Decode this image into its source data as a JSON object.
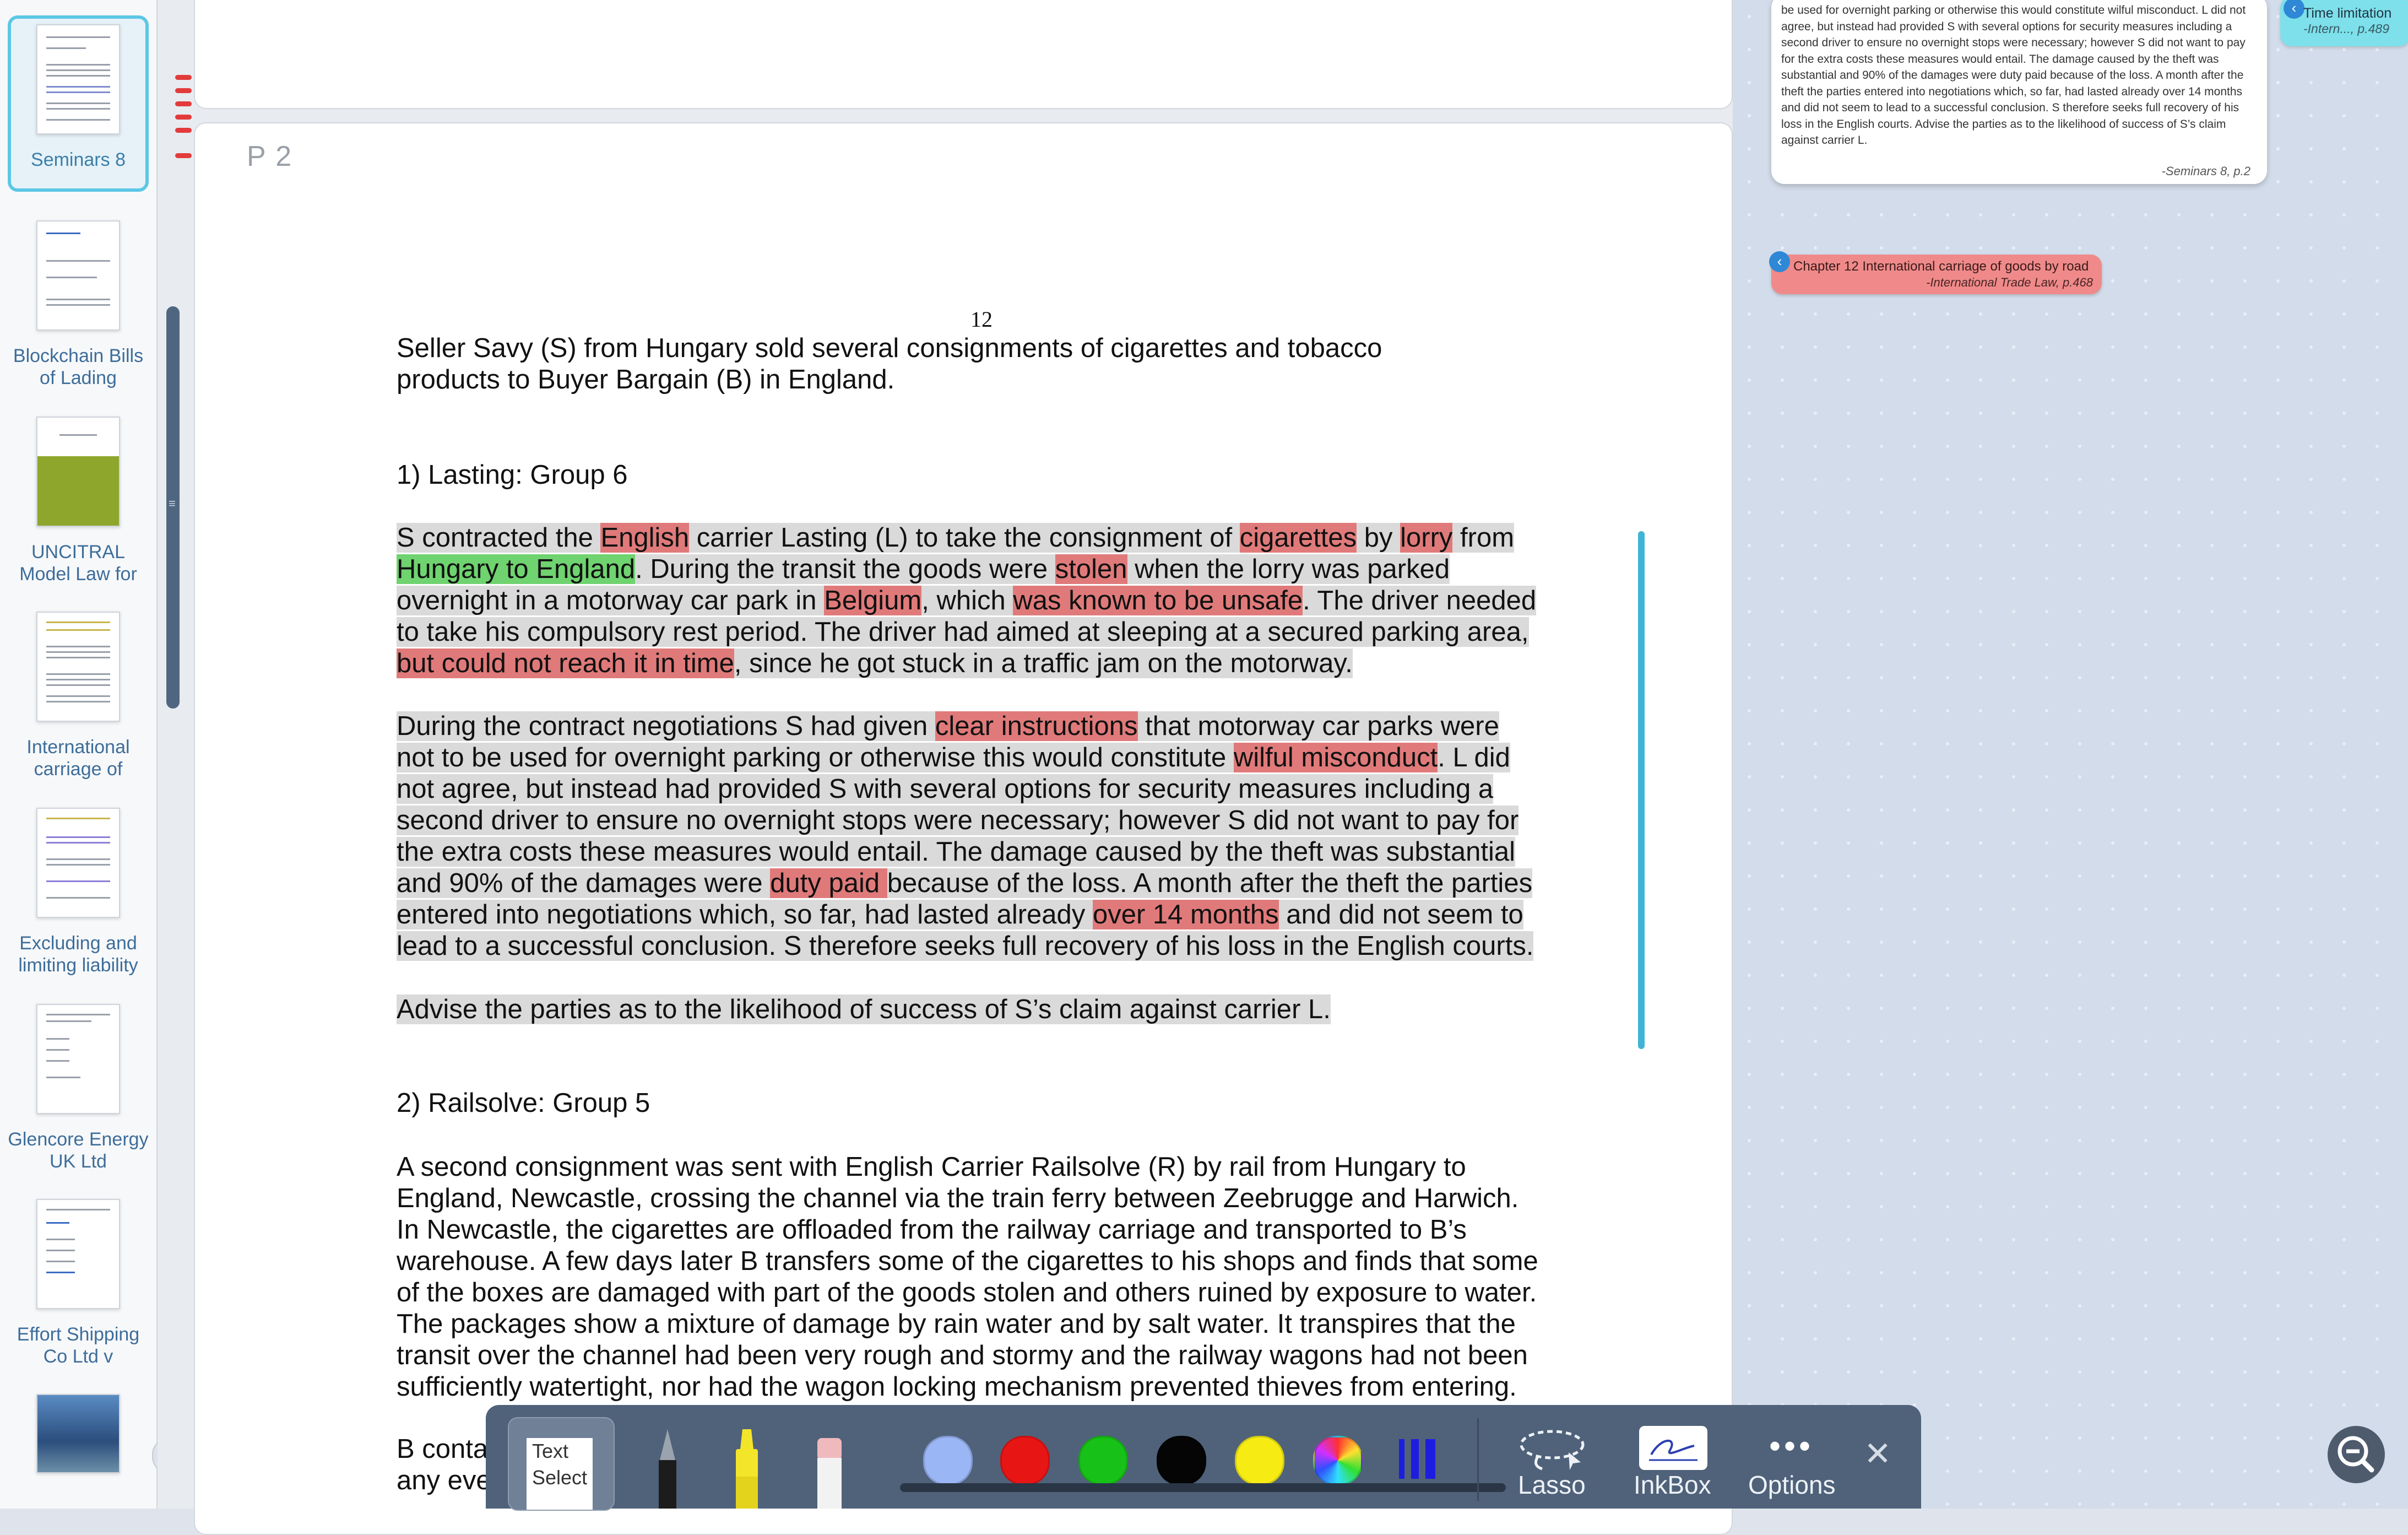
{
  "sidebar": {
    "documents": [
      {
        "label": "Seminars 8",
        "selected": true
      },
      {
        "label": "Blockchain Bills of Lading",
        "selected": false
      },
      {
        "label": "UNCITRAL Model Law for",
        "selected": false
      },
      {
        "label": "International carriage of",
        "selected": false
      },
      {
        "label": "Excluding and limiting liability",
        "selected": false
      },
      {
        "label": "Glencore Energy UK Ltd",
        "selected": false
      },
      {
        "label": "Effort Shipping Co Ltd v",
        "selected": false
      },
      {
        "label": "",
        "selected": false
      }
    ]
  },
  "document": {
    "page_label": "P 2",
    "page_number": "12",
    "intro": [
      "Seller Savy (S) from Hungary sold several consignments of cigarettes and tobacco",
      "products to Buyer Bargain (B) in England."
    ],
    "heading1": "1) Lasting:     Group 6",
    "heading2": "2) Railsolve:  Group 5",
    "p1": [
      [
        [
          "S contracted the ",
          ""
        ],
        [
          "English",
          "red"
        ],
        [
          " carrier Lasting (L) to take the consignment of ",
          ""
        ],
        [
          "cigarettes",
          "red"
        ],
        [
          " by ",
          ""
        ],
        [
          "lorry",
          "red"
        ],
        [
          " from",
          ""
        ]
      ],
      [
        [
          "Hungary to England",
          "green"
        ],
        [
          ". During the transit the goods were ",
          ""
        ],
        [
          "stolen",
          "red"
        ],
        [
          " when the lorry was parked",
          ""
        ]
      ],
      [
        [
          "overnight in a motorway car park in ",
          ""
        ],
        [
          "Belgium",
          "red"
        ],
        [
          ", which ",
          ""
        ],
        [
          "was known to be unsafe",
          "red"
        ],
        [
          ". The driver needed",
          ""
        ]
      ],
      [
        [
          "to take his compulsory rest period. The driver had aimed at sleeping at a secured parking area,",
          ""
        ]
      ],
      [
        [
          "but could not reach it in time",
          "red"
        ],
        [
          ", since he got stuck in a traffic jam on the motorway.",
          ""
        ]
      ]
    ],
    "p2": [
      [
        [
          "During the contract negotiations S had given ",
          ""
        ],
        [
          "clear instructions",
          "red"
        ],
        [
          " that motorway car parks were",
          ""
        ]
      ],
      [
        [
          "not to be used for overnight parking or otherwise this would constitute ",
          ""
        ],
        [
          "wilful misconduct",
          "red"
        ],
        [
          ". L did",
          ""
        ]
      ],
      [
        [
          "not agree, but instead had provided S with several options for security measures including a",
          ""
        ]
      ],
      [
        [
          "second driver to ensure no overnight stops were necessary; however S did not want to pay for",
          ""
        ]
      ],
      [
        [
          "the extra costs these measures would entail. The damage caused by the theft was substantial",
          ""
        ]
      ],
      [
        [
          "and 90% of the damages were ",
          ""
        ],
        [
          "duty paid ",
          "red"
        ],
        [
          "because of the loss. A month after the theft the parties",
          ""
        ]
      ],
      [
        [
          "entered into negotiations which, so far, had lasted already ",
          ""
        ],
        [
          "over 14 months",
          "red"
        ],
        [
          " and did not seem to",
          ""
        ]
      ],
      [
        [
          "lead to a successful conclusion. S therefore seeks full recovery of his loss in the English courts.",
          ""
        ]
      ]
    ],
    "p3": [
      [
        [
          "Advise the parties as to the likelihood of success of S’s claim against carrier L.",
          ""
        ]
      ]
    ],
    "p4": [
      "A second consignment was sent with English Carrier Railsolve (R) by rail from Hungary to",
      "England, Newcastle, crossing the channel via the train ferry between Zeebrugge and Harwich.",
      "In Newcastle, the cigarettes are offloaded from the railway carriage and transported to B’s",
      "warehouse. A few days later B transfers some of the cigarettes to his shops and finds that some",
      "of the boxes are damaged with part of the goods stolen and others ruined by exposure to water.",
      "The packages show a mixture of damage by rain water and by salt water. It transpires that the",
      "transit over the channel had been very rough and stormy and the railway wagons had not been",
      "sufficiently watertight, nor had the wagon locking mechanism prevented thieves from entering."
    ],
    "p5": [
      "B conta",
      "any eve"
    ]
  },
  "notes": {
    "card_text": "be used for overnight parking or otherwise this would constitute wilful misconduct. L did   not agree, but instead had provided S with several options for security measures including a   second driver to ensure no overnight stops were necessary; however S did not want to pay for   the extra costs these measures would entail. The damage caused by the theft was substantial   and 90% of the damages were duty paid because of the loss. A month after the theft the parties  entered into negotiations which, so far, had lasted already over 14 months and did not seem to lead to a successful conclusion. S therefore seeks full recovery of his loss in the English courts.   Advise the parties as to the likelihood of success of S’s claim against carrier L.",
    "card_source": "-Seminars 8, p.2",
    "time_tag_title": "Time limitation",
    "time_tag_source": "-Intern..., p.489",
    "chapter_tag_title": "Chapter 12  International carriage of goods by road",
    "chapter_tag_source": "-International Trade Law, p.468"
  },
  "toolbar": {
    "text_select_label": "Text Select",
    "colors": [
      "#9bb6f5",
      "#e81515",
      "#17c117",
      "#050505",
      "#f6ec14",
      "rainbow",
      "#1d1de0"
    ],
    "lasso_label": "Lasso",
    "inkbox_label": "InkBox",
    "options_label": "Options"
  }
}
